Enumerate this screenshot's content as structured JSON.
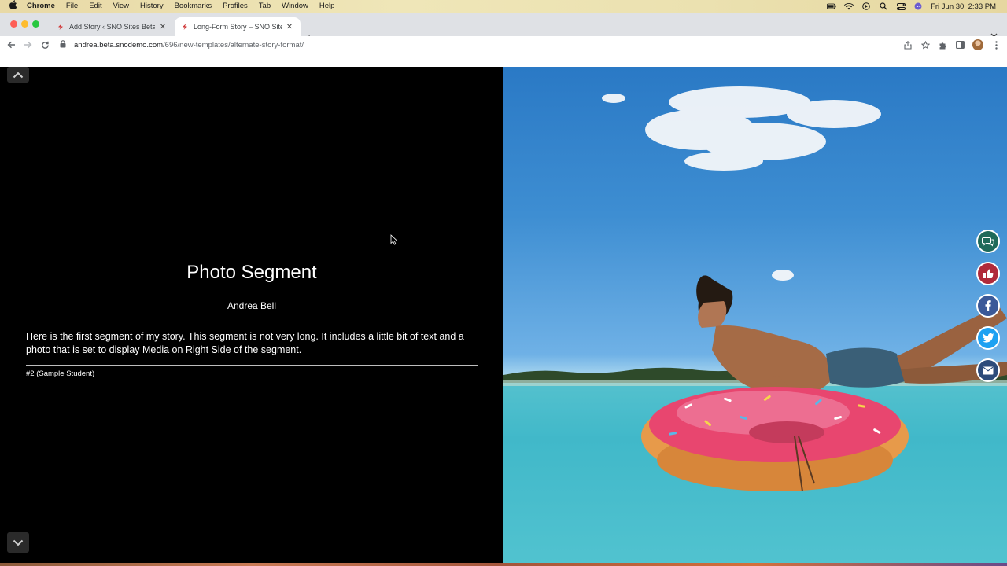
{
  "menubar": {
    "app": "Chrome",
    "items": [
      "File",
      "Edit",
      "View",
      "History",
      "Bookmarks",
      "Profiles",
      "Tab",
      "Window",
      "Help"
    ],
    "clock": "Fri Jun 30  2:33 PM"
  },
  "tabs": [
    {
      "title": "Add Story ‹ SNO Sites Beta Te",
      "active": false
    },
    {
      "title": "Long-Form Story – SNO Sites B",
      "active": true
    }
  ],
  "address": {
    "host": "andrea.beta.snodemo.com",
    "path": "/696/new-templates/alternate-story-format/"
  },
  "story": {
    "title": "Photo Segment",
    "author": "Andrea Bell",
    "body": "Here is the first segment of my story. This segment is not very long. It includes a little bit of text and a photo that is set to display Media on Right Side of the segment.",
    "caption": "#2 (Sample Student)"
  },
  "share_buttons": [
    {
      "name": "comment",
      "icon": "comment-icon",
      "color": "#1f6a5a"
    },
    {
      "name": "like",
      "icon": "thumbs-up-icon",
      "color": "#b02a3a"
    },
    {
      "name": "facebook",
      "icon": "facebook-icon",
      "color": "#3b5998"
    },
    {
      "name": "twitter",
      "icon": "twitter-icon",
      "color": "#1da1f2"
    },
    {
      "name": "email",
      "icon": "email-icon",
      "color": "#2c4b7a"
    }
  ]
}
